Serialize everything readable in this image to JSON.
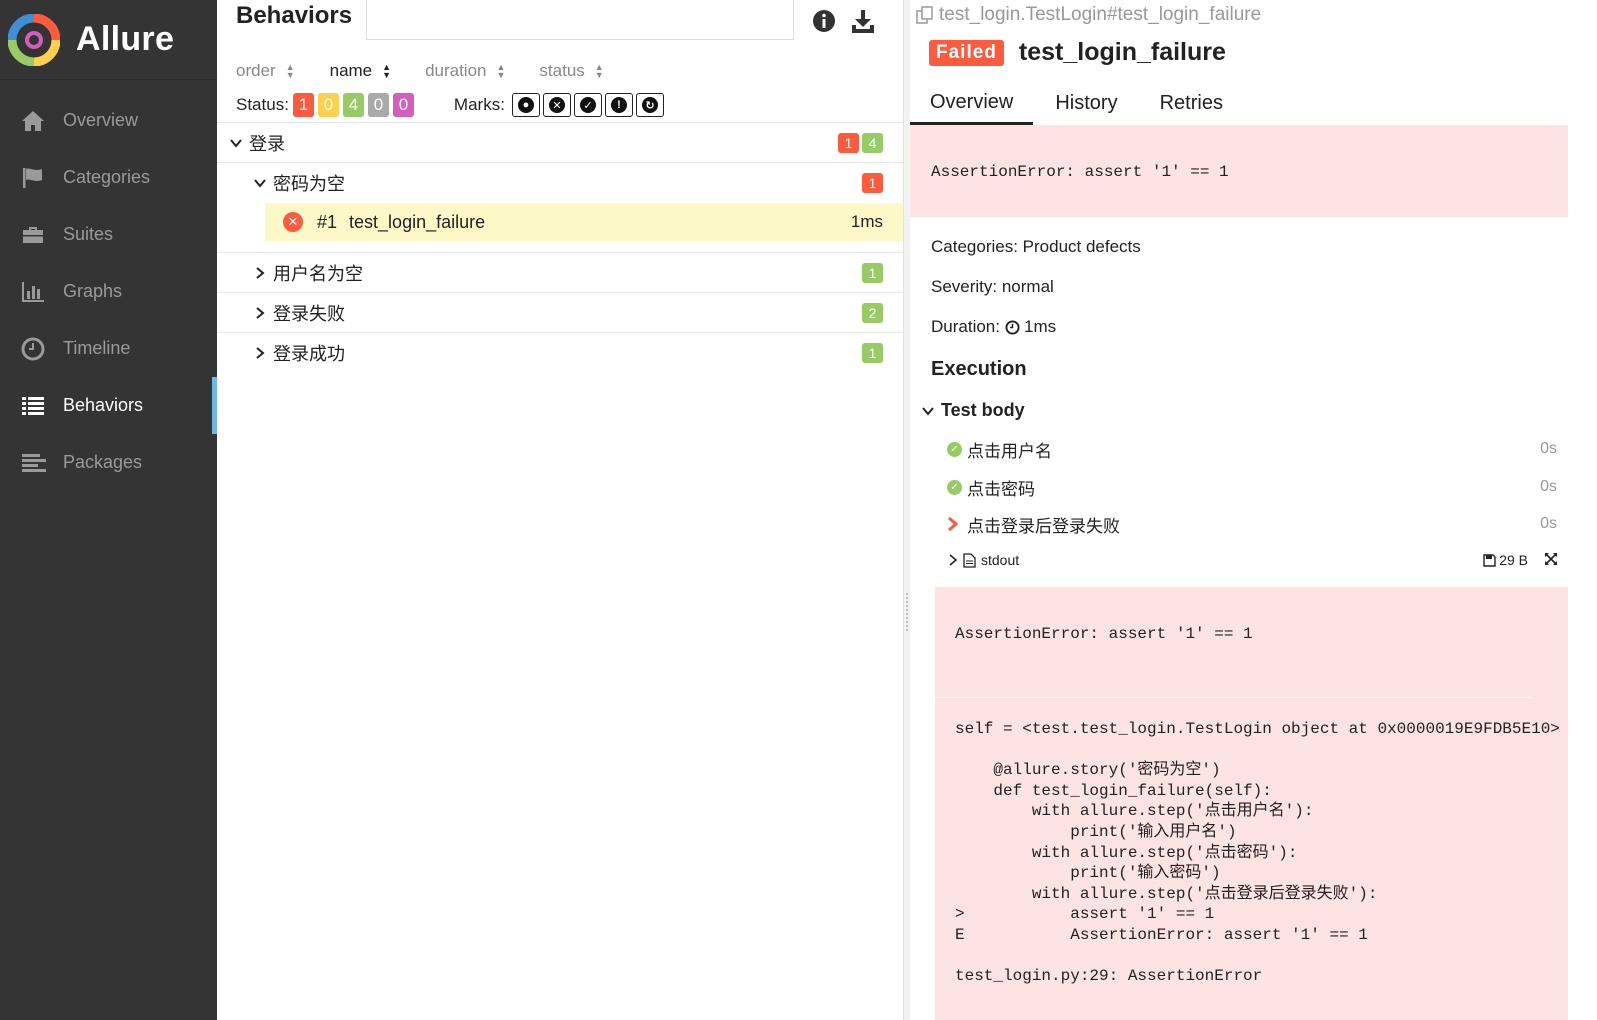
{
  "brand": {
    "name": "Allure"
  },
  "sidebar": {
    "items": [
      {
        "label": "Overview",
        "icon": "home-icon"
      },
      {
        "label": "Categories",
        "icon": "flag-icon"
      },
      {
        "label": "Suites",
        "icon": "briefcase-icon"
      },
      {
        "label": "Graphs",
        "icon": "bar-chart-icon"
      },
      {
        "label": "Timeline",
        "icon": "clock-icon"
      },
      {
        "label": "Behaviors",
        "icon": "list-icon",
        "active": true
      },
      {
        "label": "Packages",
        "icon": "align-left-icon"
      }
    ]
  },
  "behaviors": {
    "title": "Behaviors",
    "search": {
      "value": "",
      "placeholder": ""
    },
    "sort": {
      "order": "order",
      "name": "name",
      "duration": "duration",
      "status": "status"
    },
    "status_label": "Status:",
    "status_counts": [
      {
        "value": "1",
        "color": "#fd5a3e"
      },
      {
        "value": "0",
        "color": "#ffd050"
      },
      {
        "value": "4",
        "color": "#97cc64"
      },
      {
        "value": "0",
        "color": "#aaaaaa"
      },
      {
        "value": "0",
        "color": "#d35ebe"
      }
    ],
    "marks_label": "Marks:",
    "marks": [
      "flaky-icon",
      "new-failed-icon",
      "new-passed-icon",
      "new-broken-icon",
      "retries-status-change-icon"
    ],
    "tree": {
      "group": {
        "label": "登录",
        "failed": "1",
        "passed": "4"
      },
      "children": [
        {
          "label": "密码为空",
          "failed": "1",
          "expanded": true,
          "leaf": {
            "index": "#1",
            "name": "test_login_failure",
            "duration": "1ms"
          }
        },
        {
          "label": "用户名为空",
          "passed": "1"
        },
        {
          "label": "登录失败",
          "passed": "2"
        },
        {
          "label": "登录成功",
          "passed": "1"
        }
      ]
    }
  },
  "detail": {
    "path": "test_login.TestLogin#test_login_failure",
    "status": "Failed",
    "title": "test_login_failure",
    "tabs": [
      "Overview",
      "History",
      "Retries"
    ],
    "error_message": "AssertionError: assert '1' == 1",
    "categories": "Categories: Product defects",
    "severity": "Severity: normal",
    "duration_label": "Duration:",
    "duration_value": "1ms",
    "execution_title": "Execution",
    "test_body": "Test body",
    "steps": [
      {
        "name": "点击用户名",
        "duration": "0s",
        "status": "passed"
      },
      {
        "name": "点击密码",
        "duration": "0s",
        "status": "passed"
      },
      {
        "name": "点击登录后登录失败",
        "duration": "0s",
        "status": "failed"
      }
    ],
    "attachment": {
      "name": "stdout",
      "size": "29 B"
    },
    "stdout_message": "AssertionError: assert '1' == 1",
    "trace": "self = <test.test_login.TestLogin object at 0x0000019E9FDB5E10>\n\n    @allure.story('密码为空')\n    def test_login_failure(self):\n        with allure.step('点击用户名'):\n            print('输入用户名')\n        with allure.step('点击密码'):\n            print('输入密码')\n        with allure.step('点击登录后登录失败'):\n>           assert '1' == 1\nE           AssertionError: assert '1' == 1\n\ntest_login.py:29: AssertionError"
  }
}
